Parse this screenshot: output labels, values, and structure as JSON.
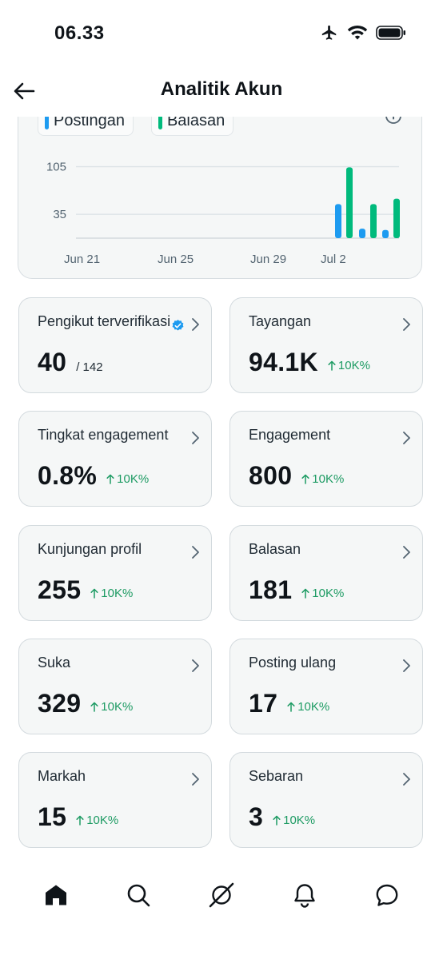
{
  "status_bar": {
    "time": "06.33"
  },
  "header": {
    "title": "Analitik Akun"
  },
  "chart_data": {
    "type": "bar",
    "x_ticks": [
      "Jun 21",
      "Jun 25",
      "Jun 29",
      "Jul 2"
    ],
    "y_ticks": [
      105,
      35
    ],
    "ylim": [
      0,
      120
    ],
    "legend_placement": "top-left",
    "series": [
      {
        "name": "Postingan",
        "color": "#1d9bf0",
        "values": [
          50,
          14,
          12
        ]
      },
      {
        "name": "Balasan",
        "color": "#00ba7c",
        "values": [
          104,
          50,
          58
        ]
      }
    ]
  },
  "metrics": [
    {
      "label": "Pengikut terverifikasi",
      "value": "40",
      "sub": "/ 142",
      "change": "",
      "verified": true
    },
    {
      "label": "Tayangan",
      "value": "94.1K",
      "sub": "",
      "change": "10K%"
    },
    {
      "label": "Tingkat engagement",
      "value": "0.8%",
      "sub": "",
      "change": "10K%"
    },
    {
      "label": "Engagement",
      "value": "800",
      "sub": "",
      "change": "10K%"
    },
    {
      "label": "Kunjungan profil",
      "value": "255",
      "sub": "",
      "change": "10K%"
    },
    {
      "label": "Balasan",
      "value": "181",
      "sub": "",
      "change": "10K%"
    },
    {
      "label": "Suka",
      "value": "329",
      "sub": "",
      "change": "10K%"
    },
    {
      "label": "Posting ulang",
      "value": "17",
      "sub": "",
      "change": "10K%"
    },
    {
      "label": "Markah",
      "value": "15",
      "sub": "",
      "change": "10K%"
    },
    {
      "label": "Sebaran",
      "value": "3",
      "sub": "",
      "change": "10K%"
    }
  ],
  "icons": {
    "back": "arrow-left-icon",
    "info": "info-icon",
    "chevron": "chevron-right-icon",
    "verified": "verified-badge-icon",
    "tabs": [
      "home-icon",
      "search-icon",
      "grok-icon",
      "bell-icon",
      "message-icon"
    ]
  },
  "colors": {
    "accent": "#1d9bf0",
    "positive": "#1d9b63",
    "card_bg": "#f5f7f7"
  }
}
